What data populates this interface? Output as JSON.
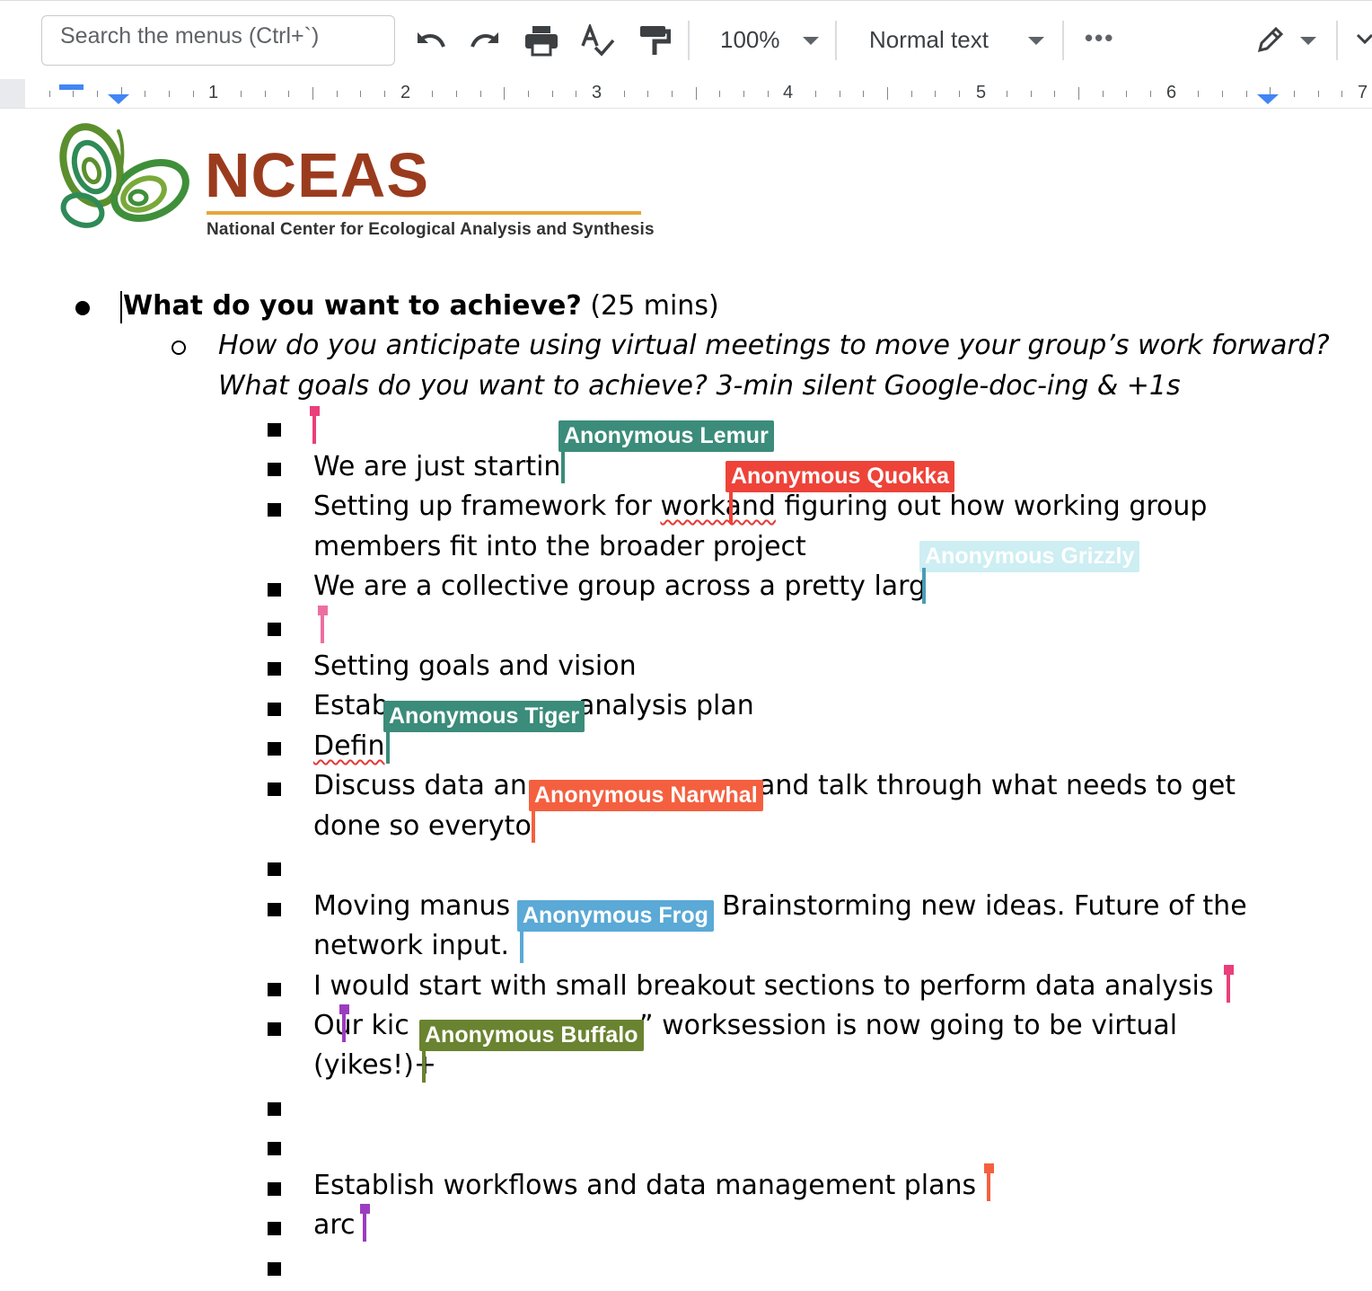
{
  "toolbar": {
    "search_placeholder": "Search the menus (Ctrl+`)",
    "zoom": "100%",
    "style": "Normal text",
    "more": "•••"
  },
  "ruler": {
    "numbers": [
      "1",
      "2",
      "3",
      "4",
      "5",
      "6",
      "7"
    ]
  },
  "logo": {
    "name": "NCEAS",
    "subtitle": "National Center for Ecological Analysis and Synthesis"
  },
  "doc": {
    "heading_bold": "What do you want to achieve?",
    "heading_rest": " (25 mins)",
    "question_line1": "How do you anticipate using virtual meetings to move your group’s work forward?",
    "question_line2": "What goals do you want to achieve? 3-min silent Google-doc-ing & +1s",
    "items": {
      "i2": "We are just startin",
      "i3a": "Setting up framework for ",
      "i3b": "workand",
      "i3c": " figuring out how working group",
      "i3d": "members fit into the broader project",
      "i4": "We are a collective group across a pretty larg",
      "i6": "Setting goals and vision",
      "i7a": "Estab",
      "i7b": "analysis plan",
      "i8": "Defin",
      "i9a": "Discuss data an",
      "i9b": "and talk through what needs to get",
      "i9c": "done so everyto",
      "i11a": "Moving manus",
      "i11b": ". Brainstorming new ideas. Future of the",
      "i11c": "network input.",
      "i12": " I would start with small breakout sections to perform data analysis",
      "i13a": " Our kic",
      "i13b": "” worksession is now going to be virtual",
      "i13c": "(yikes!)+",
      "i16": " Establish workflows and data management plans",
      "i17": " arc"
    }
  },
  "collaborators": {
    "lemur": "Anonymous Lemur",
    "quokka": "Anonymous Quokka",
    "grizzly": "Anonymous Grizzly",
    "tiger": "Anonymous Tiger",
    "narwhal": "Anonymous Narwhal",
    "frog": "Anonymous Frog",
    "buffalo": "Anonymous Buffalo"
  },
  "colors": {
    "lemur": "#3b8c7a",
    "quokka": "#ee4339",
    "grizzly": "#cdeef2",
    "tiger": "#3b8c7a",
    "narwhal": "#f4603f",
    "frog": "#5aa9d6",
    "buffalo": "#6a8330",
    "pink_cursor": "#ea3f7b",
    "purple_cursor": "#9c3cbf",
    "orange_cursor": "#f4603f"
  }
}
